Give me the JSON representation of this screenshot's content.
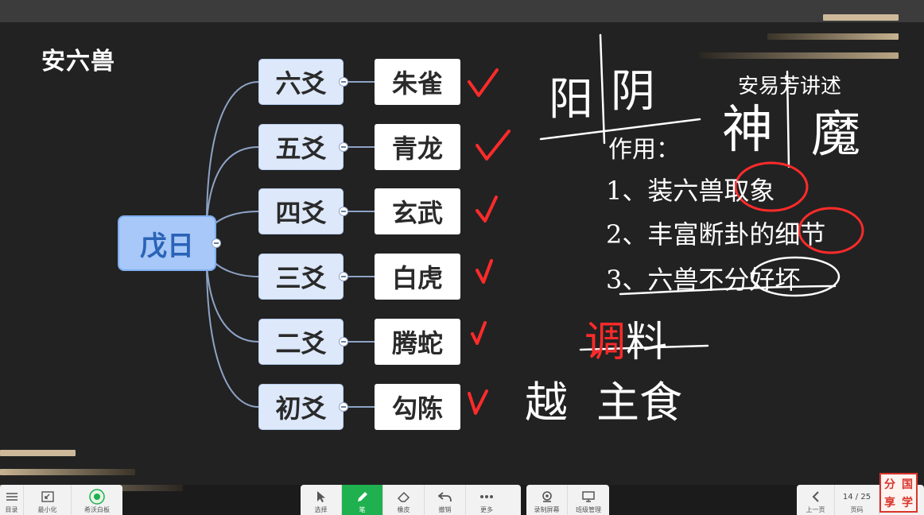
{
  "slide": {
    "title": "安六兽",
    "root": "戊日",
    "rows": [
      {
        "yao": "六爻",
        "beast": "朱雀"
      },
      {
        "yao": "五爻",
        "beast": "青龙"
      },
      {
        "yao": "四爻",
        "beast": "玄武"
      },
      {
        "yao": "三爻",
        "beast": "白虎"
      },
      {
        "yao": "二爻",
        "beast": "腾蛇"
      },
      {
        "yao": "初爻",
        "beast": "勾陈"
      }
    ]
  },
  "annotations": {
    "yang": "阳",
    "yin": "阴",
    "lecturer": "安易芳讲述",
    "shen": "神",
    "mo": "魔",
    "usage_title": "作用：",
    "point1_text": "1、装六兽",
    "point1_circled": "取象",
    "point2_text": "2、丰富断卦的",
    "point2_circled": "细节",
    "point3_text": "3、六兽不分",
    "point3_circled": "好坏",
    "seasoning_circled": "调",
    "seasoning": "料",
    "main_food": "主食",
    "main_food_prefix": "越"
  },
  "toolbar": {
    "left": [
      {
        "icon": "menu-icon",
        "label": "目录"
      },
      {
        "icon": "minimize-icon",
        "label": "最小化"
      },
      {
        "icon": "app-logo-icon",
        "label": "希沃白板"
      }
    ],
    "center": [
      {
        "icon": "cursor-icon",
        "label": "选择"
      },
      {
        "icon": "pen-icon",
        "label": "笔"
      },
      {
        "icon": "eraser-icon",
        "label": "橡皮"
      },
      {
        "icon": "undo-icon",
        "label": "撤销"
      },
      {
        "icon": "more-icon",
        "label": "更多"
      }
    ],
    "center_right": [
      {
        "icon": "camera-icon",
        "label": "录制屏幕"
      },
      {
        "icon": "class-manage-icon",
        "label": "班级管理"
      }
    ],
    "prev_label": "上一页",
    "page_indicator": "14 / 25",
    "pages_label": "页码",
    "next_label": "下一页"
  },
  "watermark": [
    "分",
    "国",
    "享",
    "学"
  ],
  "colors": {
    "accent_green": "#1fb04f",
    "check_red": "#ff2b2b",
    "node_blue": "#a7c8f8",
    "root_text": "#2a63b7"
  }
}
